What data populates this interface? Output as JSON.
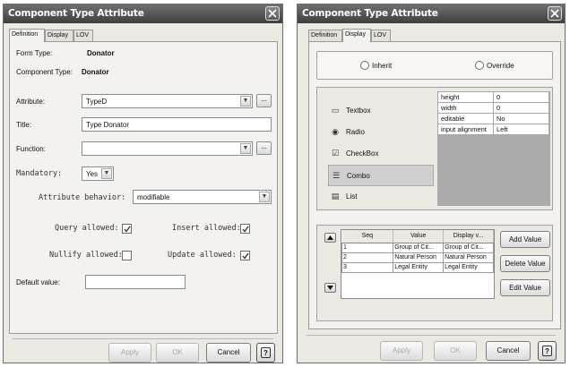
{
  "left_dialog": {
    "title": "Component Type Attribute",
    "tabs": [
      "Definition",
      "Display",
      "LOV"
    ],
    "form_type_label": "Form Type:",
    "form_type_value": "Donator",
    "component_type_label": "Component Type:",
    "component_type_value": "Donator",
    "attribute_label": "Attribute:",
    "attribute_value": "TypeD",
    "title_label": "Title:",
    "title_value": "Type Donator",
    "function_label": "Function:",
    "function_value": "",
    "mandatory_label": "Mandatory:",
    "mandatory_value": "Yes",
    "attribute_behavior_label": "Attribute behavior:",
    "attribute_behavior_value": "modifiable",
    "query_allowed_label": "Query allowed:",
    "query_allowed": true,
    "insert_allowed_label": "Insert allowed:",
    "insert_allowed": true,
    "nullify_allowed_label": "Nullify allowed:",
    "nullify_allowed": false,
    "update_allowed_label": "Update allowed:",
    "update_allowed": true,
    "default_value_label": "Default value:",
    "default_value": "",
    "browse_label": "...",
    "apply_label": "Apply",
    "ok_label": "OK",
    "cancel_label": "Cancel",
    "help_label": "?"
  },
  "right_dialog": {
    "title": "Component Type Attribute",
    "tabs": [
      "Definition",
      "Display",
      "LOV"
    ],
    "inherit_label": "Inherit",
    "override_label": "Override",
    "components": [
      {
        "label": "Textbox",
        "icon": "textbox-icon"
      },
      {
        "label": "Radio",
        "icon": "radio-icon"
      },
      {
        "label": "CheckBox",
        "icon": "checkbox-icon"
      },
      {
        "label": "Combo",
        "icon": "combo-icon"
      },
      {
        "label": "List",
        "icon": "list-icon"
      }
    ],
    "selected_component": "Combo",
    "properties": [
      {
        "key": "height",
        "value": "0"
      },
      {
        "key": "width",
        "value": "0"
      },
      {
        "key": "editable",
        "value": "No"
      },
      {
        "key": "input alignment",
        "value": "Left"
      }
    ],
    "lov_columns": [
      "Seq",
      "Value",
      "Display v..."
    ],
    "lov_rows": [
      {
        "seq": "1",
        "value": "Group of Cit...",
        "display": "Group of Cit..."
      },
      {
        "seq": "2",
        "value": "Natural Person",
        "display": "Natural Person"
      },
      {
        "seq": "3",
        "value": "Legal Entity",
        "display": "Legal Entity"
      }
    ],
    "add_value_label": "Add Value",
    "delete_value_label": "Delete Value",
    "edit_value_label": "Edit Value",
    "apply_label": "Apply",
    "ok_label": "OK",
    "cancel_label": "Cancel",
    "help_label": "?"
  },
  "colors": {
    "titlebar": "#4f4f4f",
    "dialog_bg": "#ece9e2",
    "selected_row": "#cfcfcf"
  }
}
